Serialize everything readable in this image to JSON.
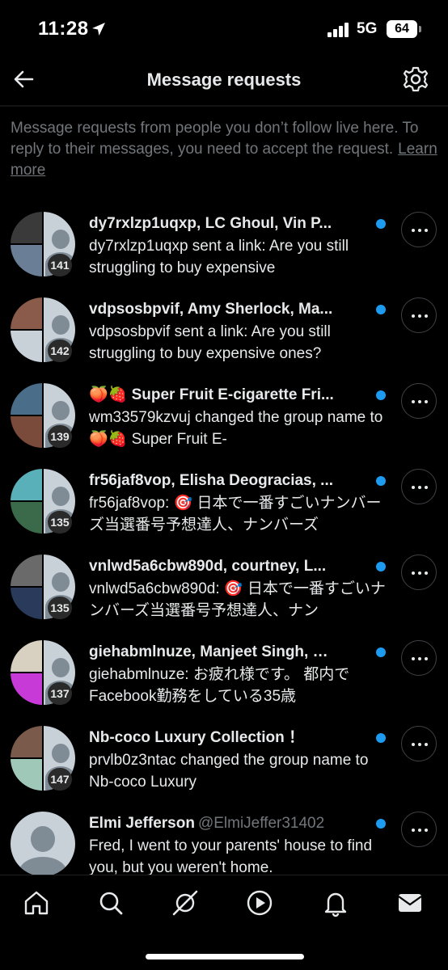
{
  "status_bar": {
    "time": "11:28",
    "network": "5G",
    "battery": "64"
  },
  "header": {
    "title": "Message requests"
  },
  "info": {
    "text": "Message requests from people you don’t follow live here. To reply to their messages, you need to accept the request.",
    "learn_more": "Learn more"
  },
  "requests": [
    {
      "title": "dy7rxlzp1uqxp, LC Ghoul, Vin P...",
      "handle": "",
      "message": "dy7rxlzp1uqxp sent a link: Are you still struggling to buy expensive",
      "count": "141",
      "unread": true,
      "avatar_colors": [
        "#3a3a3a",
        "#6a7f95"
      ]
    },
    {
      "title": "vdpsosbpvif, Amy Sherlock, Ma...",
      "handle": "",
      "message": "vdpsosbpvif sent a link: Are you still struggling to buy expensive ones?",
      "count": "142",
      "unread": true,
      "avatar_colors": [
        "#8a5a4a",
        "#c8d0d8"
      ]
    },
    {
      "title": "🍑🍓 Super Fruit E-cigarette Fri...",
      "handle": "",
      "message": "wm33579kzvuj changed the group name to 🍑🍓 Super Fruit E-",
      "count": "139",
      "unread": true,
      "avatar_colors": [
        "#4a6e8a",
        "#7a4a3a"
      ]
    },
    {
      "title": "fr56jaf8vop, Elisha Deogracias, ...",
      "handle": "",
      "message": "fr56jaf8vop: 🎯 日本で一番すごいナンバーズ当選番号予想達人、ナンバーズ",
      "count": "135",
      "unread": true,
      "avatar_colors": [
        "#5ab0b8",
        "#3a6a4a"
      ]
    },
    {
      "title": "vnlwd5a6cbw890d, courtney, L...",
      "handle": "",
      "message": "vnlwd5a6cbw890d: 🎯 日本で一番すごいナンバーズ当選番号予想達人、ナン",
      "count": "135",
      "unread": true,
      "avatar_colors": [
        "#6a6a6a",
        "#2a3a5a"
      ]
    },
    {
      "title": "giehabmlnuze, Manjeet Singh, …",
      "handle": "",
      "message": "giehabmlnuze: お疲れ様です。 都内でFacebook勤務をしている35歳",
      "count": "137",
      "unread": true,
      "avatar_colors": [
        "#d8d0c0",
        "#c83ad8"
      ]
    },
    {
      "title": "Nb-coco Luxury Collection ！",
      "handle": "",
      "message": "prvlb0z3ntac changed the group name to Nb-coco Luxury",
      "count": "147",
      "unread": true,
      "avatar_colors": [
        "#7a5a4a",
        "#a0c8b8"
      ]
    },
    {
      "title": "Elmi Jefferson",
      "handle": "@ElmiJeffer31402",
      "message": "Fred, I went to your parents' house to find you, but you weren't home.",
      "count": "",
      "unread": true,
      "avatar_colors": [
        "#c8d0d8",
        "#c8d0d8"
      ]
    }
  ],
  "nav": {
    "items": [
      "home-icon",
      "search-icon",
      "grok-icon",
      "video-icon",
      "notifications-icon",
      "messages-icon"
    ]
  }
}
